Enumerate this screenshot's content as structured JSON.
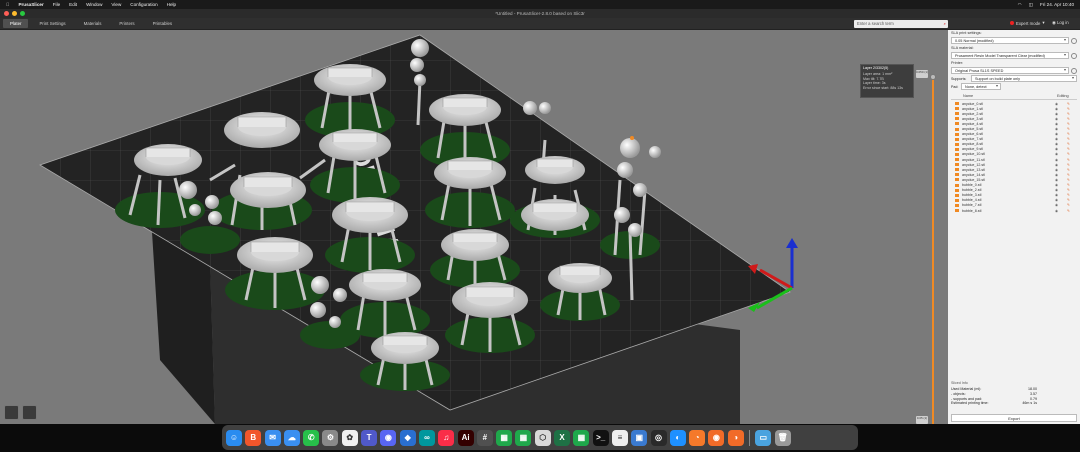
{
  "menubar": {
    "app": "PrusaSlicer",
    "items": [
      "File",
      "Edit",
      "Window",
      "View",
      "Configuration",
      "Help"
    ],
    "clock": "Fri 24. Apr 10:40"
  },
  "window": {
    "title": "*Untitled - PrusaSlicer-2.8.0 based on Slic3r"
  },
  "toolbar": {
    "tabs": [
      "Plater",
      "Print Settings",
      "Materials",
      "Printers",
      "Printables"
    ],
    "search_placeholder": "Enter a search term",
    "mode_label": "Expert mode",
    "login_label": "Log in"
  },
  "layer_tip": {
    "header": "Layer 2/3302(5)",
    "lines": [
      "Layer area: 1 mm²",
      "Max tilt: 7.7B",
      "Layer time: 3s",
      "Error since start: 88s 13s"
    ]
  },
  "slider": {
    "top_label": "0.050 (1)",
    "bottom_label": "0.05 (1)"
  },
  "sidebar": {
    "sla_print_label": "SLA print settings:",
    "sla_print_value": "0.05 Normal (modified)",
    "sla_material_label": "SLA material:",
    "sla_material_value": "Prusament Resin Model Transparent Clear (modified)",
    "printer_label": "Printer:",
    "printer_value": "Original Prusa SL1S SPEED",
    "supports_label": "Supports:",
    "supports_value": "Support on build plate only",
    "pad_label": "Pad:",
    "pad_value": "None, detect",
    "col_name": "Name",
    "col_editing": "Editing",
    "objects": [
      "anyclue_0.stl",
      "anyclue_1.stl",
      "anyclue_2.stl",
      "anyclue_3.stl",
      "anyclue_4.stl",
      "anyclue_5.stl",
      "anyclue_6.stl",
      "anyclue_7.stl",
      "anyclue_8.stl",
      "anyclue_9.stl",
      "anyclue_10.stl",
      "anyclue_11.stl",
      "anyclue_12.stl",
      "anyclue_13.stl",
      "anyclue_14.stl",
      "anyclue_15.stl",
      "bubble_0.stl",
      "bubble_2.stl",
      "bubble_3.stl",
      "bubble_4.stl",
      "bubble_7.stl",
      "bubble_8.stl"
    ],
    "info": {
      "title": "Sliced Info",
      "rows": [
        {
          "k": "Used Material (ml):",
          "v": "18.00"
        },
        {
          "k": "- objects:",
          "v": "3.57"
        },
        {
          "k": "- supports and pad:",
          "v": "0.79"
        },
        {
          "k": "Estimated printing time:",
          "v": "46m s 1s"
        }
      ]
    },
    "export_label": "Export"
  },
  "dock": {
    "icons": [
      {
        "name": "finder-icon",
        "color": "#2a8cf0",
        "glyph": "☺"
      },
      {
        "name": "brave-icon",
        "color": "#f1562b",
        "glyph": "B"
      },
      {
        "name": "mail-icon",
        "color": "#3a8ff0",
        "glyph": "✉"
      },
      {
        "name": "messages-icon",
        "color": "#3a8ff0",
        "glyph": "☁"
      },
      {
        "name": "whatsapp-icon",
        "color": "#27c04a",
        "glyph": "✆"
      },
      {
        "name": "settings-icon",
        "color": "#8a8a8a",
        "glyph": "⚙"
      },
      {
        "name": "photos-icon",
        "color": "#f0f0f0",
        "glyph": "✿"
      },
      {
        "name": "teams-icon",
        "color": "#5059c9",
        "glyph": "T"
      },
      {
        "name": "discord-icon",
        "color": "#5865f2",
        "glyph": "◉"
      },
      {
        "name": "prusaslicer-icon",
        "color": "#2a6fd0",
        "glyph": "◆"
      },
      {
        "name": "arduino-icon",
        "color": "#00979d",
        "glyph": "∞"
      },
      {
        "name": "music-icon",
        "color": "#fa2d48",
        "glyph": "♫"
      },
      {
        "name": "illustrator-icon",
        "color": "#330000",
        "glyph": "Ai"
      },
      {
        "name": "calculator-icon",
        "color": "#505050",
        "glyph": "#"
      },
      {
        "name": "numbers-icon",
        "color": "#1fa84b",
        "glyph": "▦"
      },
      {
        "name": "sheets-icon",
        "color": "#1fa84b",
        "glyph": "▦"
      },
      {
        "name": "box-icon",
        "color": "#d8d8d8",
        "glyph": "⬡"
      },
      {
        "name": "excel-icon",
        "color": "#1e7145",
        "glyph": "X"
      },
      {
        "name": "spreadsheet-icon",
        "color": "#1fa84b",
        "glyph": "▦"
      },
      {
        "name": "terminal-icon",
        "color": "#111111",
        "glyph": ">_"
      },
      {
        "name": "notes-icon",
        "color": "#eeeeee",
        "glyph": "≡"
      },
      {
        "name": "preview-icon",
        "color": "#3a7ad0",
        "glyph": "▣"
      },
      {
        "name": "davinci-icon",
        "color": "#2a2a2a",
        "glyph": "◎"
      },
      {
        "name": "safari-icon",
        "color": "#1e90ff",
        "glyph": "◐"
      },
      {
        "name": "blender-icon",
        "color": "#f5792a",
        "glyph": "◔"
      },
      {
        "name": "houdini-icon",
        "color": "#f16b28",
        "glyph": "◉"
      },
      {
        "name": "cura-icon",
        "color": "#f16b28",
        "glyph": "◑"
      },
      {
        "name": "folder-icon",
        "color": "#4aa3df",
        "glyph": "▭"
      },
      {
        "name": "trash-icon",
        "color": "#9a9a9a",
        "glyph": "🗑"
      }
    ]
  },
  "colors": {
    "accent": "#f08a24",
    "bed": "#1e1e1e",
    "support": "#c9c9c9",
    "pad": "#1a4a1a"
  }
}
